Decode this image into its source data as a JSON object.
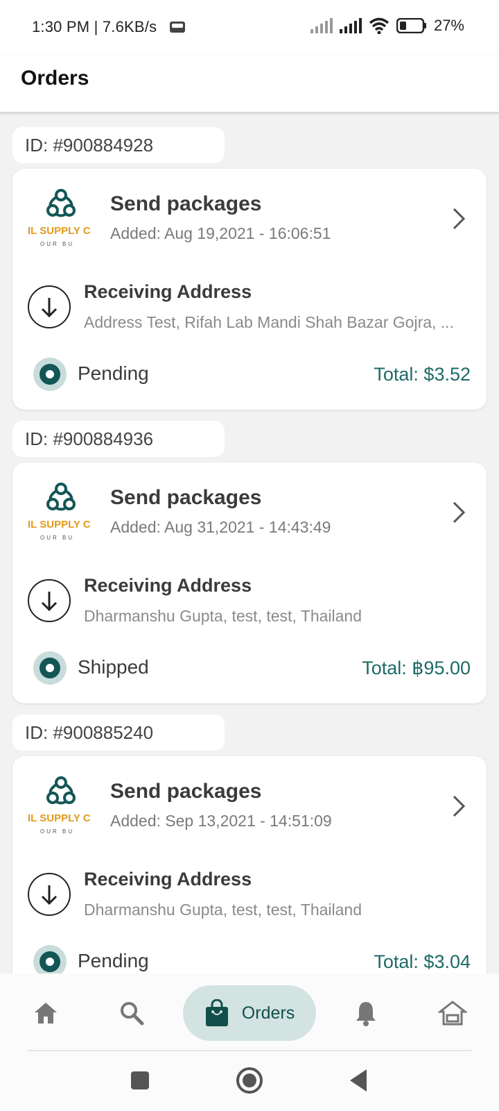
{
  "status_bar": {
    "time": "1:30 PM | 7.6KB/s",
    "battery": "27%"
  },
  "header": {
    "title": "Orders"
  },
  "orders": [
    {
      "id": "ID: #900884928",
      "title": "Send packages",
      "added": "Added: Aug 19,2021 - 16:06:51",
      "address_label": "Receiving Address",
      "address": "Address Test, Rifah Lab Mandi Shah Bazar Gojra, ...",
      "status": "Pending",
      "total": "Total: $3.52"
    },
    {
      "id": "ID: #900884936",
      "title": "Send packages",
      "added": "Added: Aug 31,2021 - 14:43:49",
      "address_label": "Receiving Address",
      "address": "Dharmanshu Gupta, test, test, Thailand",
      "status": "Shipped",
      "total": "Total: ฿95.00"
    },
    {
      "id": "ID: #900885240",
      "title": "Send packages",
      "added": "Added: Sep 13,2021 - 14:51:09",
      "address_label": "Receiving Address",
      "address": "Dharmanshu Gupta, test, test, Thailand",
      "status": "Pending",
      "total": "Total: $3.04"
    }
  ],
  "logo": {
    "text": "IL SUPPLY C",
    "tagline": "OUR BU"
  },
  "bottom_nav": {
    "active_label": "Orders",
    "items": [
      "home-icon",
      "search-icon",
      "orders-bag-icon",
      "notifications-icon",
      "store-icon"
    ]
  },
  "colors": {
    "accent": "#145656",
    "accent_light": "#d2e3e1",
    "total_text": "#1e6a66",
    "logo_orange": "#e39a1a"
  }
}
